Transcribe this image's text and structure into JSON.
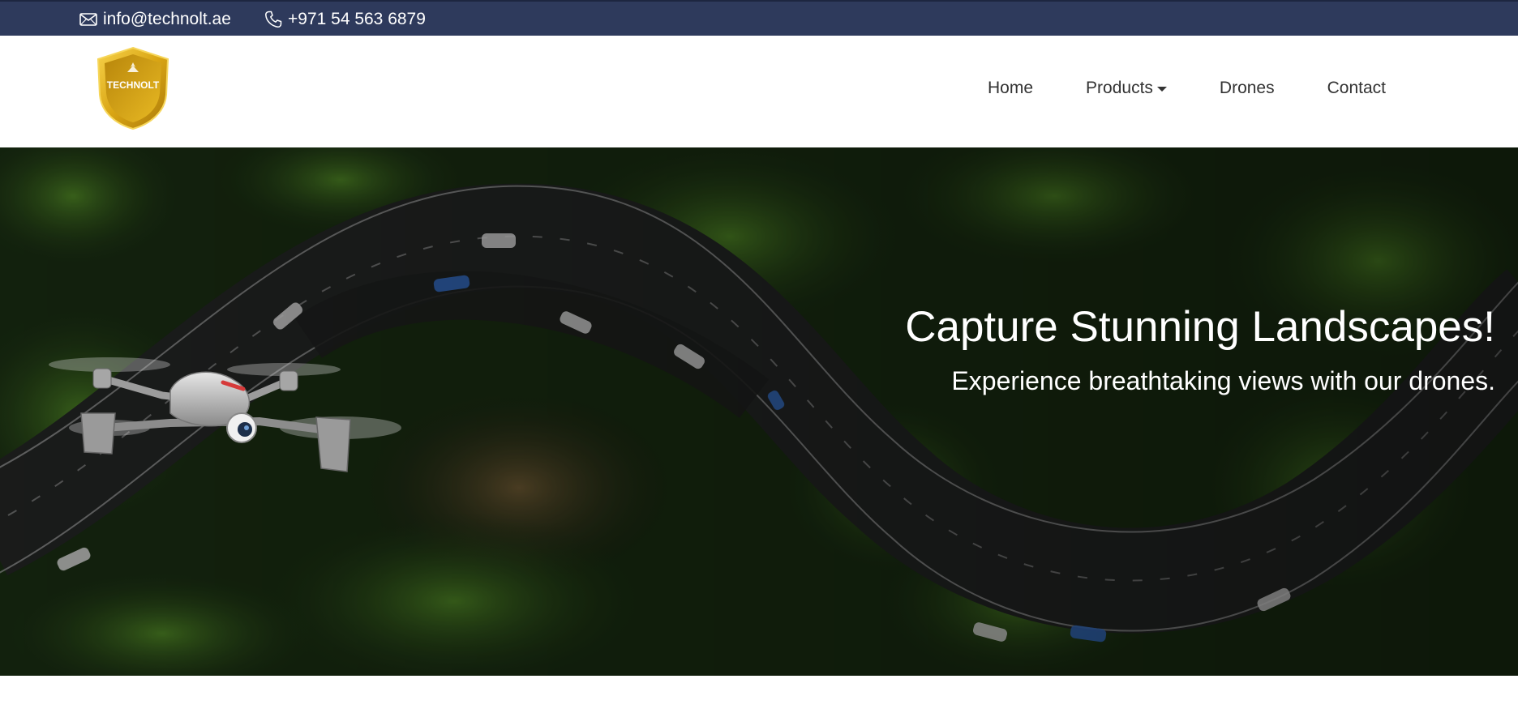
{
  "topbar": {
    "email": "info@technolt.ae",
    "phone": "+971 54 563 6879",
    "email_icon": "envelope-icon",
    "phone_icon": "phone-icon",
    "background": "#2e3a5c"
  },
  "brand": {
    "logo_text": "TECHNOLT",
    "logo_colors": [
      "#c89b0d",
      "#f0c419"
    ]
  },
  "nav": {
    "items": [
      {
        "label": "Home"
      },
      {
        "label": "Products",
        "has_dropdown": true
      },
      {
        "label": "Drones"
      },
      {
        "label": "Contact"
      }
    ]
  },
  "hero": {
    "title": "Capture Stunning Landscapes!",
    "subtitle": "Experience breathtaking views with our drones.",
    "image": "aerial-forest-road-with-drone"
  }
}
